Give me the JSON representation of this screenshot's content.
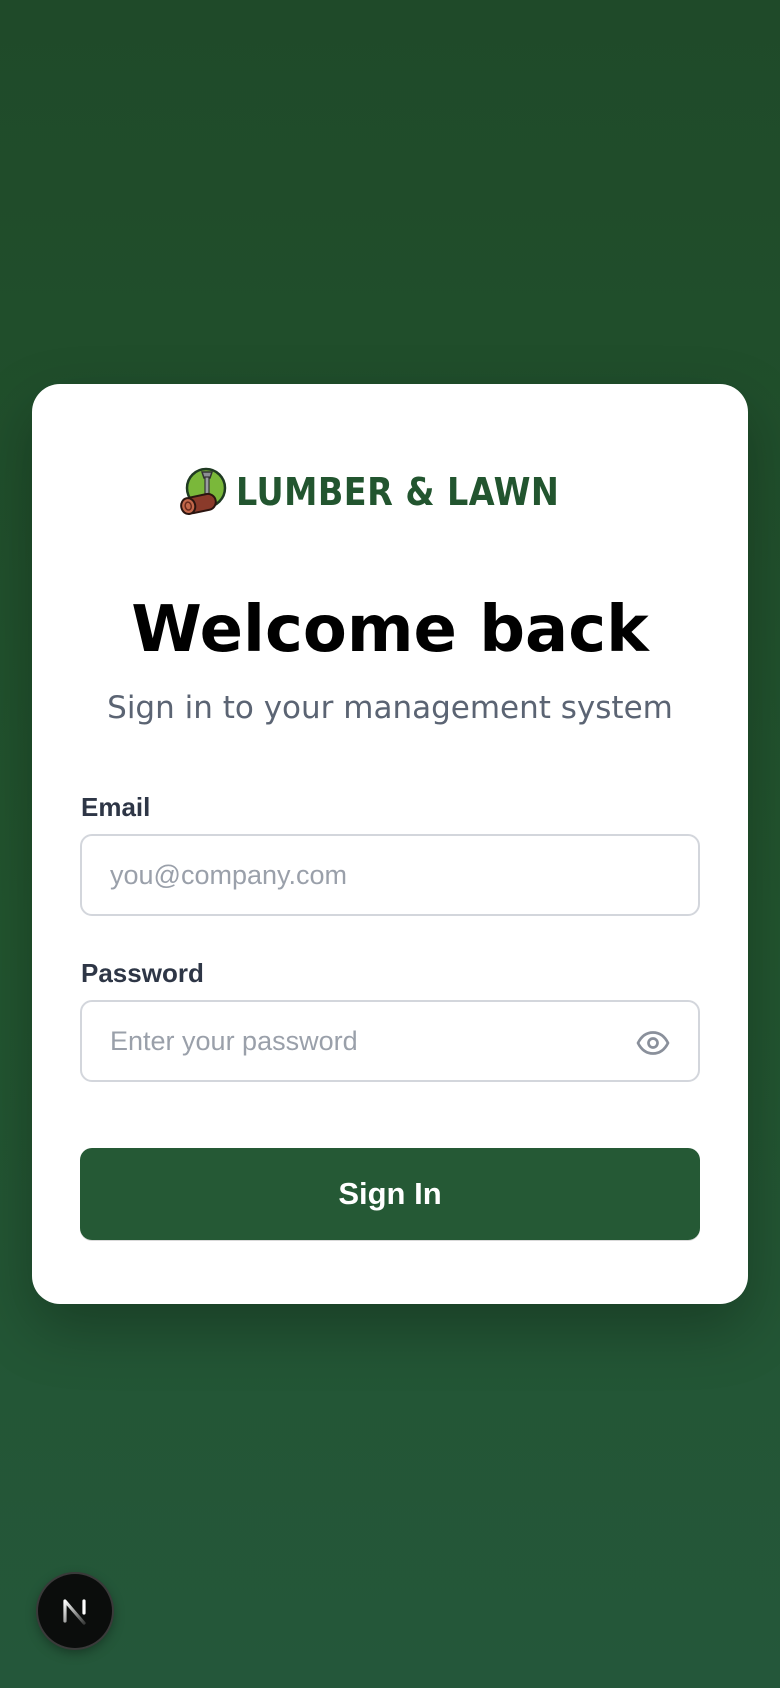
{
  "brand": {
    "name": "LUMBER & LAWN",
    "color": "#22552f",
    "accent_green": "#7ab83a",
    "log_color": "#8a3a2a"
  },
  "login": {
    "title": "Welcome back",
    "subtitle": "Sign in to your management system",
    "email": {
      "label": "Email",
      "placeholder": "you@company.com",
      "value": ""
    },
    "password": {
      "label": "Password",
      "placeholder": "Enter your password",
      "value": "",
      "toggle_icon": "eye-icon"
    },
    "submit_label": "Sign In"
  },
  "dev_badge": {
    "letter": "N",
    "icon": "nextjs-icon"
  },
  "colors": {
    "background": "#22522d",
    "button": "#255935",
    "title": "#000000",
    "subtitle": "#5b6473"
  }
}
